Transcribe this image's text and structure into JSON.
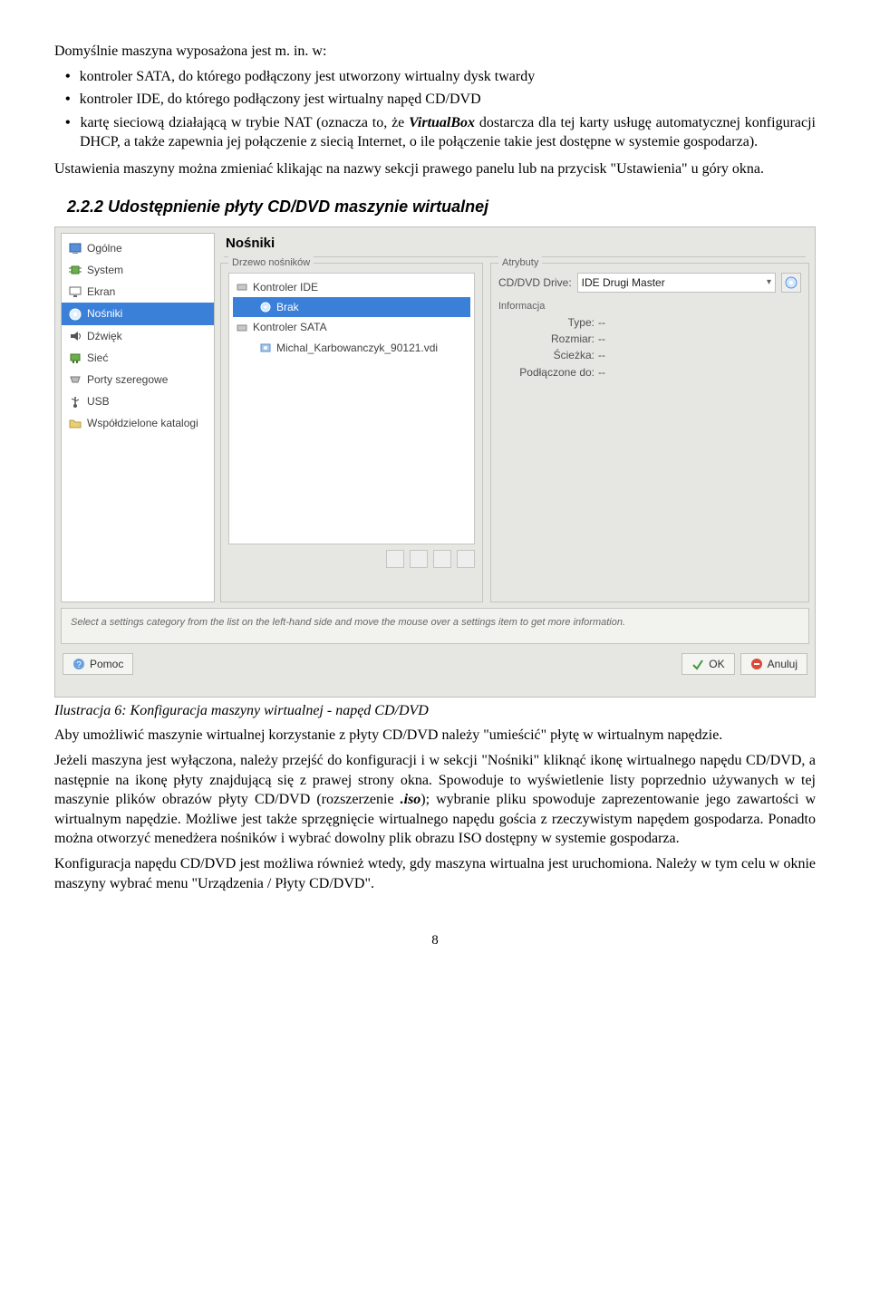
{
  "intro_line": "Domyślnie maszyna wyposażona jest m. in. w:",
  "bullets": {
    "b1": "kontroler SATA, do którego podłączony jest utworzony wirtualny dysk twardy",
    "b2": "kontroler IDE, do którego podłączony jest wirtualny napęd CD/DVD",
    "b3_pre": "kartę sieciową działającą w trybie NAT (oznacza to, że ",
    "b3_em": "VirtualBox",
    "b3_post": " dostarcza dla tej karty usługę automatycznej konfiguracji DHCP, a także zapewnia jej połączenie z siecią Internet, o ile połączenie takie jest dostępne w systemie gospodarza)."
  },
  "para_after_bullets": "Ustawienia maszyny można zmieniać klikając na nazwy sekcji prawego panelu lub na przycisk \"Ustawienia\" u góry okna.",
  "section_heading": "2.2.2  Udostępnienie płyty CD/DVD maszynie wirtualnej",
  "figure_caption": "Ilustracja 6: Konfiguracja maszyny wirtualnej - napęd CD/DVD",
  "para_after_fig": "Aby umożliwić maszynie wirtualnej korzystanie z płyty CD/DVD należy \"umieścić\" płytę w wirtualnym napędzie.",
  "para3_pre": "Jeżeli maszyna jest wyłączona, należy przejść do konfiguracji i w sekcji \"Nośniki\" kliknąć ikonę wirtualnego napędu CD/DVD, a następnie na ikonę płyty znajdującą się z prawej strony okna. Spowoduje to wyświetlenie listy poprzednio używanych w tej maszynie plików obrazów płyty CD/DVD (rozszerzenie ",
  "para3_em": ".iso",
  "para3_post": "); wybranie pliku spowoduje zaprezentowanie jego zawartości w wirtualnym napędzie. Możliwe jest także sprzęgnięcie wirtualnego napędu gościa z rzeczywistym napędem gospodarza. Ponadto można otworzyć menedżera nośników i wybrać dowolny plik obrazu ISO dostępny w systemie gospodarza.",
  "para4": "Konfiguracja napędu CD/DVD jest możliwa również wtedy, gdy maszyna wirtualna jest uruchomiona. Należy w tym celu w oknie maszyny wybrać menu \"Urządzenia / Płyty CD/DVD\".",
  "page_number": "8",
  "vb": {
    "panel_title": "Nośniki",
    "sidebar": [
      "Ogólne",
      "System",
      "Ekran",
      "Nośniki",
      "Dźwięk",
      "Sieć",
      "Porty szeregowe",
      "USB",
      "Współdzielone katalogi"
    ],
    "tree_legend": "Drzewo nośników",
    "attr_legend": "Atrybuty",
    "tree": {
      "ctrl_ide": "Kontroler IDE",
      "empty": "Brak",
      "ctrl_sata": "Kontroler SATA",
      "vdi": "Michal_Karbowanczyk_90121.vdi"
    },
    "attr": {
      "drive_label": "CD/DVD Drive:",
      "drive_value": "IDE Drugi Master",
      "info_title": "Informacja",
      "k_type": "Type:",
      "k_size": "Rozmiar:",
      "k_path": "Ścieżka:",
      "k_att": "Podłączone do:",
      "dash": "--"
    },
    "hint": "Select a settings category from the list on the left-hand side and move the mouse over a settings item to get more information.",
    "buttons": {
      "help": "Pomoc",
      "ok": "OK",
      "cancel": "Anuluj"
    }
  }
}
